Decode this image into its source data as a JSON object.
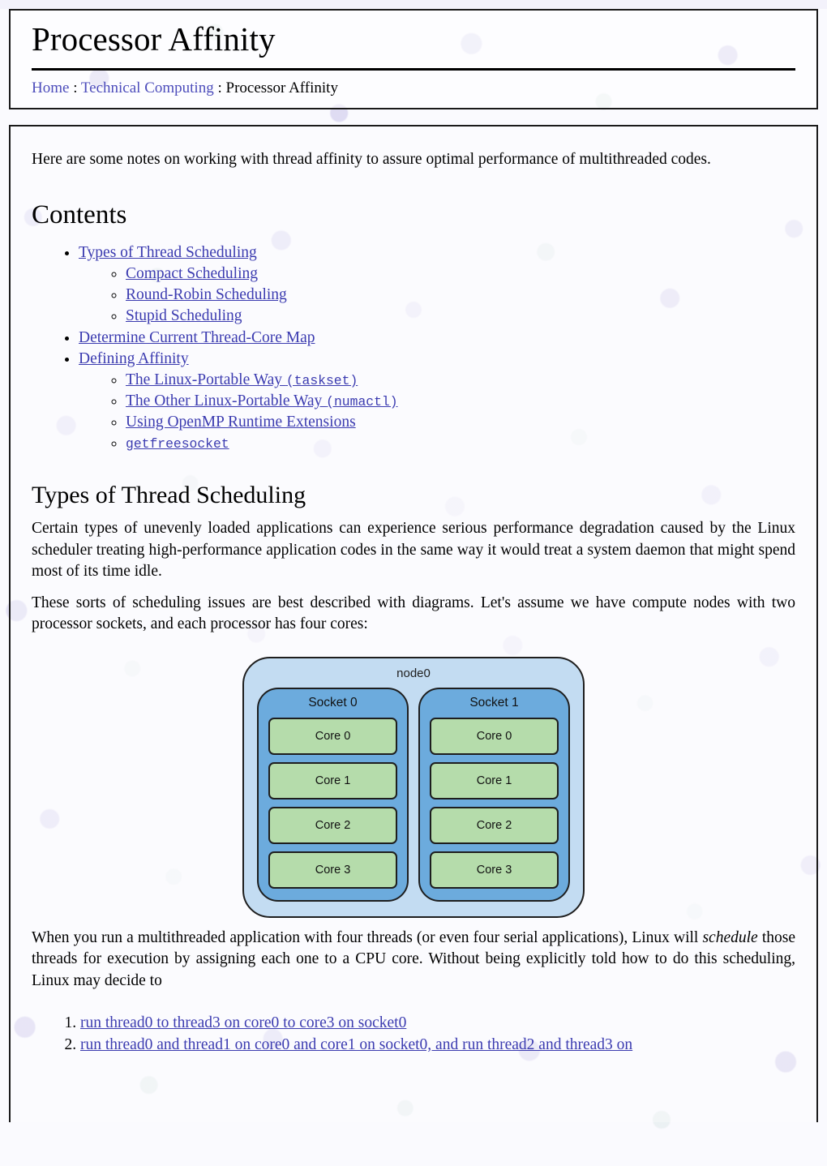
{
  "header": {
    "site_title": "Processor Affinity",
    "breadcrumb": {
      "home": "Home",
      "sep1": " : ",
      "parent": "Technical Computing",
      "sep2": " : ",
      "current": "Processor Affinity"
    }
  },
  "intro": {
    "paragraph": "Here are some notes on working with thread affinity to assure optimal performance of multithreaded codes."
  },
  "contents": {
    "heading": "Contents",
    "items": [
      {
        "label": "Types of Thread Scheduling",
        "children": [
          {
            "label": "Compact Scheduling"
          },
          {
            "label": "Round-Robin Scheduling"
          },
          {
            "label": "Stupid Scheduling"
          }
        ]
      },
      {
        "label": "Determine Current Thread-Core Map",
        "children": []
      },
      {
        "label": "Defining Affinity",
        "children": [
          {
            "label": "The Linux-Portable Way ",
            "code": "(taskset)"
          },
          {
            "label": "The Other Linux-Portable Way ",
            "code": "(numactl)"
          },
          {
            "label": "Using OpenMP Runtime Extensions"
          },
          {
            "label": "",
            "code": "getfreesocket"
          }
        ]
      }
    ]
  },
  "section_scheduling": {
    "heading": "Types of Thread Scheduling",
    "paragraph1": "Certain types of unevenly loaded applications can experience serious performance degradation caused by the Linux scheduler treating high-performance application codes in the same way it would treat a system daemon that might spend most of its time idle.",
    "paragraph2": "These sorts of scheduling issues are best described with diagrams. Let's assume we have compute nodes with two processor sockets, and each processor has four cores:"
  },
  "diagram": {
    "node_label": "node0",
    "sockets": [
      {
        "label": "Socket 0",
        "cores": [
          "Core 0",
          "Core 1",
          "Core 2",
          "Core 3"
        ]
      },
      {
        "label": "Socket 1",
        "cores": [
          "Core 0",
          "Core 1",
          "Core 2",
          "Core 3"
        ]
      }
    ],
    "colors": {
      "node_fill": "#c3dcf2",
      "socket_fill": "#6cabdd",
      "core_fill": "#b5dcab",
      "stroke": "#1e1e1e"
    }
  },
  "after_diagram": {
    "paragraph_part1": "When you run a multithreaded application with four threads (or even four serial applications), Linux will ",
    "paragraph_emphasis": "schedule",
    "paragraph_part2": " those threads for execution by assigning each one to a CPU core. Without being explicitly told how to do this scheduling, Linux may decide to",
    "options": [
      "run thread0 to thread3 on core0 to core3 on socket0",
      "run thread0 and thread1 on core0 and core1 on socket0, and run thread2 and thread3 on"
    ]
  },
  "theme": {
    "link_color": "#3b3bb0",
    "breadcrumb_link_color": "#4d4dbb",
    "text_color": "#000000"
  }
}
